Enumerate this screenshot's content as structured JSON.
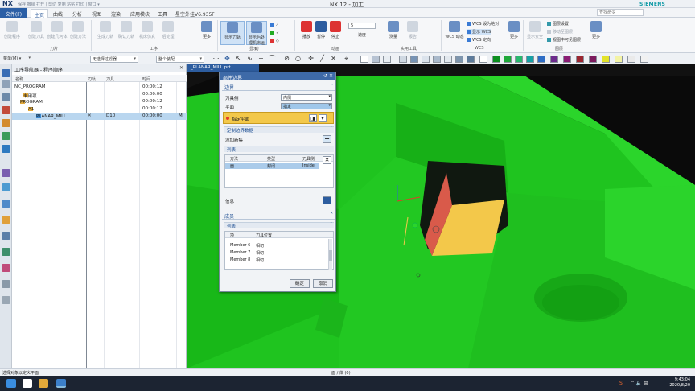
{
  "app": {
    "logo": "NX",
    "title": "NX 12 - 加工",
    "brand": "SIEMENS",
    "quick_access": "保存  撤销  打开  |  剪切  复制  粘贴  打印  |  窗口 ▾",
    "find_placeholder": "查找命令"
  },
  "tabs": [
    "文件(F)",
    "主页",
    "曲线",
    "分析",
    "视图",
    "渲染",
    "应用模块",
    "工具",
    "星空外挂V6.935F"
  ],
  "ribbon": {
    "buttons": [
      {
        "label": "创建程序",
        "on": false
      },
      {
        "label": "创建刀具",
        "on": false
      },
      {
        "label": "创建几何体",
        "on": false
      },
      {
        "label": "创建方法",
        "on": false
      },
      {
        "label": "生成刀轨",
        "on": false
      },
      {
        "label": "确认刀轨",
        "on": false
      },
      {
        "label": "机床仿真",
        "on": false
      },
      {
        "label": "后处理",
        "on": false
      },
      {
        "label": "更多",
        "on": true
      },
      {
        "label": "显示刀轨",
        "on": true
      },
      {
        "label": "显示所有",
        "on": true
      },
      {
        "label": "播放",
        "on": true
      },
      {
        "label": "暂停",
        "on": true
      },
      {
        "label": "停止",
        "on": true
      },
      {
        "label": "速度",
        "on": true
      },
      {
        "label": "测量",
        "on": true
      },
      {
        "label": "报告",
        "on": false
      },
      {
        "label": "WCS 动态",
        "on": true
      },
      {
        "label": "更多",
        "on": true
      },
      {
        "label": "显示安全",
        "on": false
      },
      {
        "label": "更多",
        "on": true
      }
    ],
    "small_items": [
      {
        "label": "WCS 设为绝对",
        "on": true
      },
      {
        "label": "显示 WCS",
        "on": true
      },
      {
        "label": "WCS 定向",
        "on": true
      },
      {
        "label": "图层设置",
        "on": true
      },
      {
        "label": "移动至图层",
        "on": false
      },
      {
        "label": "视图中可见图层",
        "on": true
      }
    ],
    "groups": [
      "刀片",
      "工序",
      "显示",
      "动画",
      "实用工具",
      "WCS",
      "图层"
    ],
    "highlight_label": "显示后处理机床运动",
    "speed_value": "5"
  },
  "selbar": {
    "menu_label": "菜单(M) ▾",
    "filter": "无选择过滤器",
    "scope": "整个装配"
  },
  "navigator": {
    "title": "工序导航器 - 程序顺序",
    "columns": [
      "名称",
      "刀轨",
      "刀具",
      "时间"
    ],
    "rows": [
      {
        "name": "NC_PROGRAM",
        "tool": "",
        "time": "00:00:12",
        "sel": false,
        "mark": false
      },
      {
        "name": "未用项",
        "tool": "",
        "time": "00:00:00",
        "sel": false,
        "mark": false
      },
      {
        "name": "PROGRAM",
        "tool": "",
        "time": "00:00:12",
        "sel": false,
        "mark": true
      },
      {
        "name": "A1",
        "tool": "",
        "time": "00:00:12",
        "sel": false,
        "mark": true
      },
      {
        "name": "PLANAR_MILL",
        "tool": "D10",
        "time": "00:00:00",
        "sel": true,
        "mark": true
      }
    ],
    "selected_path_mark": "✕",
    "last_col_mark": "M"
  },
  "viewport": {
    "tab": "_PLANAR_MILL.prt"
  },
  "dialog": {
    "title": "部件边界",
    "section_boundary": "边界",
    "tool_side_label": "刀具侧",
    "tool_side_value": "内侧",
    "plane_label": "平面",
    "plane_value": "指定",
    "specify_plane": "指定平面",
    "custom_boundary": "定制边界数据",
    "add_new": "添加新集",
    "list_label": "列表",
    "list_columns": [
      "方法",
      "类型",
      "刀具侧"
    ],
    "list_rows": [
      {
        "method": "面",
        "type": "封闭",
        "side": "Inside"
      }
    ],
    "info_label": "信息",
    "section_members": "成员",
    "member_columns": [
      "项",
      "刀具位置"
    ],
    "members": [
      {
        "item": "Member 6",
        "pos": "相切"
      },
      {
        "item": "Member 7",
        "pos": "相切"
      },
      {
        "item": "Member 8",
        "pos": "相切"
      }
    ],
    "ok": "确定",
    "cancel": "取消"
  },
  "status": {
    "left": "选择对象以定义平面",
    "center": "面 / 体 (0)"
  },
  "clock": {
    "time": "9:43:04",
    "date": "2020/8/20"
  },
  "colors": {
    "model_green": "#1fc41f",
    "wall_red": "#d95a4a",
    "floor_yellow": "#f3c84a",
    "accent_blue": "#2b5fa6"
  }
}
